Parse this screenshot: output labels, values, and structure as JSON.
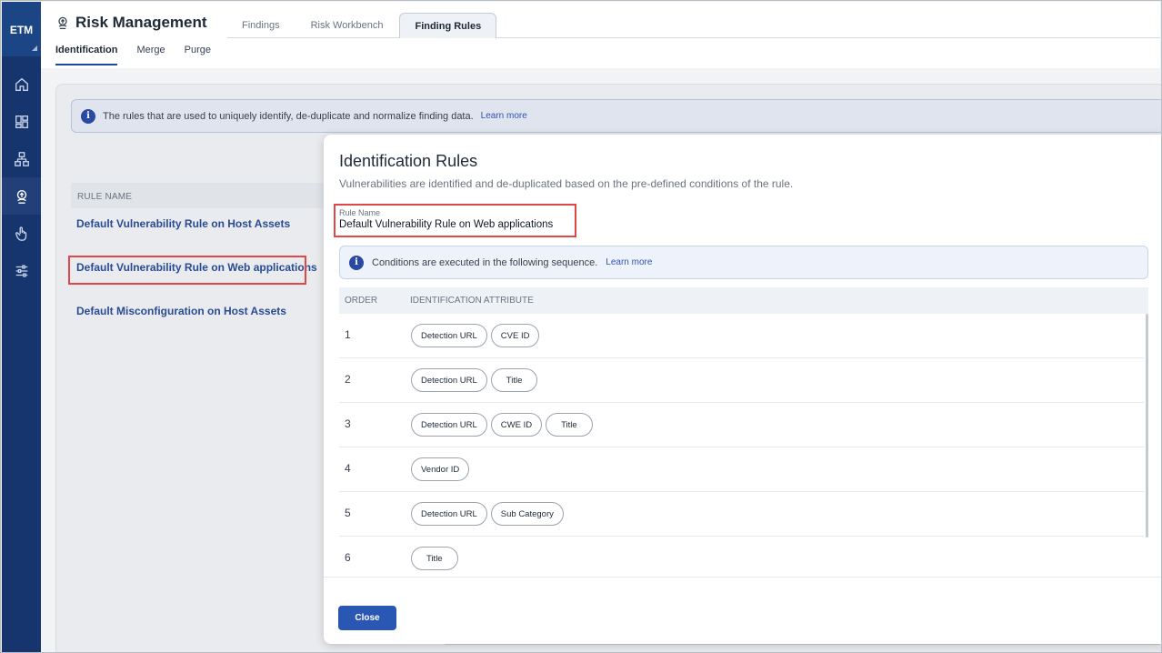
{
  "sidebar": {
    "logo": "ETM",
    "items": [
      {
        "icon": "home-icon"
      },
      {
        "icon": "dashboard-icon"
      },
      {
        "icon": "network-icon"
      },
      {
        "icon": "risk-icon",
        "active": true
      },
      {
        "icon": "hand-pointer-icon"
      },
      {
        "icon": "sliders-icon"
      }
    ]
  },
  "header": {
    "title": "Risk Management",
    "tabs": [
      "Findings",
      "Risk Workbench",
      "Finding Rules"
    ],
    "active_tab": "Finding Rules",
    "sub_tabs": [
      "Identification",
      "Merge",
      "Purge"
    ],
    "active_sub_tab": "Identification"
  },
  "background": {
    "banner_text": "The rules that are used to uniquely identify, de-duplicate and normalize finding data.",
    "banner_link": "Learn more",
    "table_header": "RULE NAME",
    "rules": [
      "Default Vulnerability Rule on Host Assets",
      "Default Vulnerability Rule on Web applications",
      "Default Misconfiguration on Host Assets"
    ]
  },
  "modal": {
    "title": "Identification Rules",
    "subtitle": "Vulnerabilities are identified and de-duplicated based on the pre-defined conditions of the rule.",
    "rule_name_label": "Rule Name",
    "rule_name_value": "Default Vulnerability Rule on Web applications",
    "conditions_text": "Conditions are executed in the following sequence.",
    "conditions_link": "Learn more",
    "columns": {
      "order": "ORDER",
      "attribute": "IDENTIFICATION ATTRIBUTE"
    },
    "rows": [
      {
        "order": "1",
        "attributes": [
          "Detection URL",
          "CVE ID"
        ]
      },
      {
        "order": "2",
        "attributes": [
          "Detection URL",
          "Title"
        ]
      },
      {
        "order": "3",
        "attributes": [
          "Detection URL",
          "CWE ID",
          "Title"
        ]
      },
      {
        "order": "4",
        "attributes": [
          "Vendor ID"
        ]
      },
      {
        "order": "5",
        "attributes": [
          "Detection URL",
          "Sub Category"
        ]
      },
      {
        "order": "6",
        "attributes": [
          "Title"
        ]
      }
    ],
    "close_label": "Close"
  },
  "colors": {
    "sidebar": "#16356f",
    "accent": "#2a56b4",
    "highlight": "#e04848"
  }
}
